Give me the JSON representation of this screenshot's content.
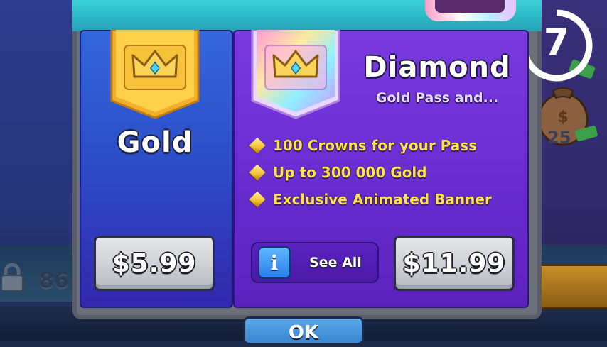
{
  "timer": {
    "value": "7"
  },
  "tiers": {
    "gold": {
      "name": "Gold",
      "price": "$5.99"
    },
    "diamond": {
      "name": "Diamond",
      "subtitle": "Gold Pass and...",
      "price": "$11.99",
      "features": [
        "100 Crowns for your Pass",
        "Up to 300 000 Gold",
        "Exclusive Animated Banner"
      ],
      "see_all_label": "See All"
    }
  },
  "background": {
    "lock_count": "86",
    "bag_count": "25"
  },
  "ok_label": "OK",
  "colors": {
    "gold_panel": "#2c4fc8",
    "diamond_panel": "#6a2ed2",
    "feature_text": "#ffe24a",
    "price_button": "#d2d4d8"
  },
  "icons": [
    "crown-icon",
    "diamond-bullet-icon",
    "info-icon",
    "lock-icon",
    "money-bag-icon"
  ]
}
